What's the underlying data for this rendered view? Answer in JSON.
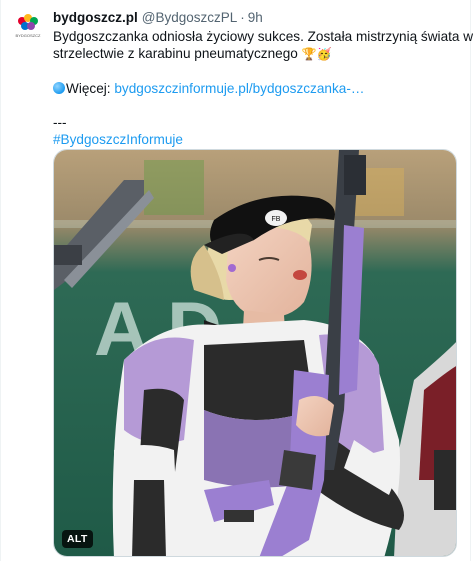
{
  "tweet": {
    "author_name": "bydgoszcz.pl",
    "author_handle": "@BydgoszczPL",
    "separator": "·",
    "time": "9h",
    "text_line1": "Bydgoszczanka odniosła życiowy sukces. Została mistrzynią świata w",
    "text_line2": "strzelectwie z karabinu pneumatycznego",
    "emojis": "🏆🥳",
    "more_label": "Więcej:",
    "link_text": "bydgoszczinformuje.pl/bydgoszczanka-…",
    "divider": "---",
    "hashtag": "#BydgoszczInformuje"
  },
  "avatar": {
    "icon": "bydgoszcz-logo-icon",
    "caption": "BYDGOSZCZ"
  },
  "media": {
    "alt_badge": "ALT",
    "backdrop_letters": "A  D",
    "visor_logo": "FB"
  },
  "colors": {
    "link": "#1d9bf0",
    "muted": "#536471",
    "text": "#0f1419"
  }
}
